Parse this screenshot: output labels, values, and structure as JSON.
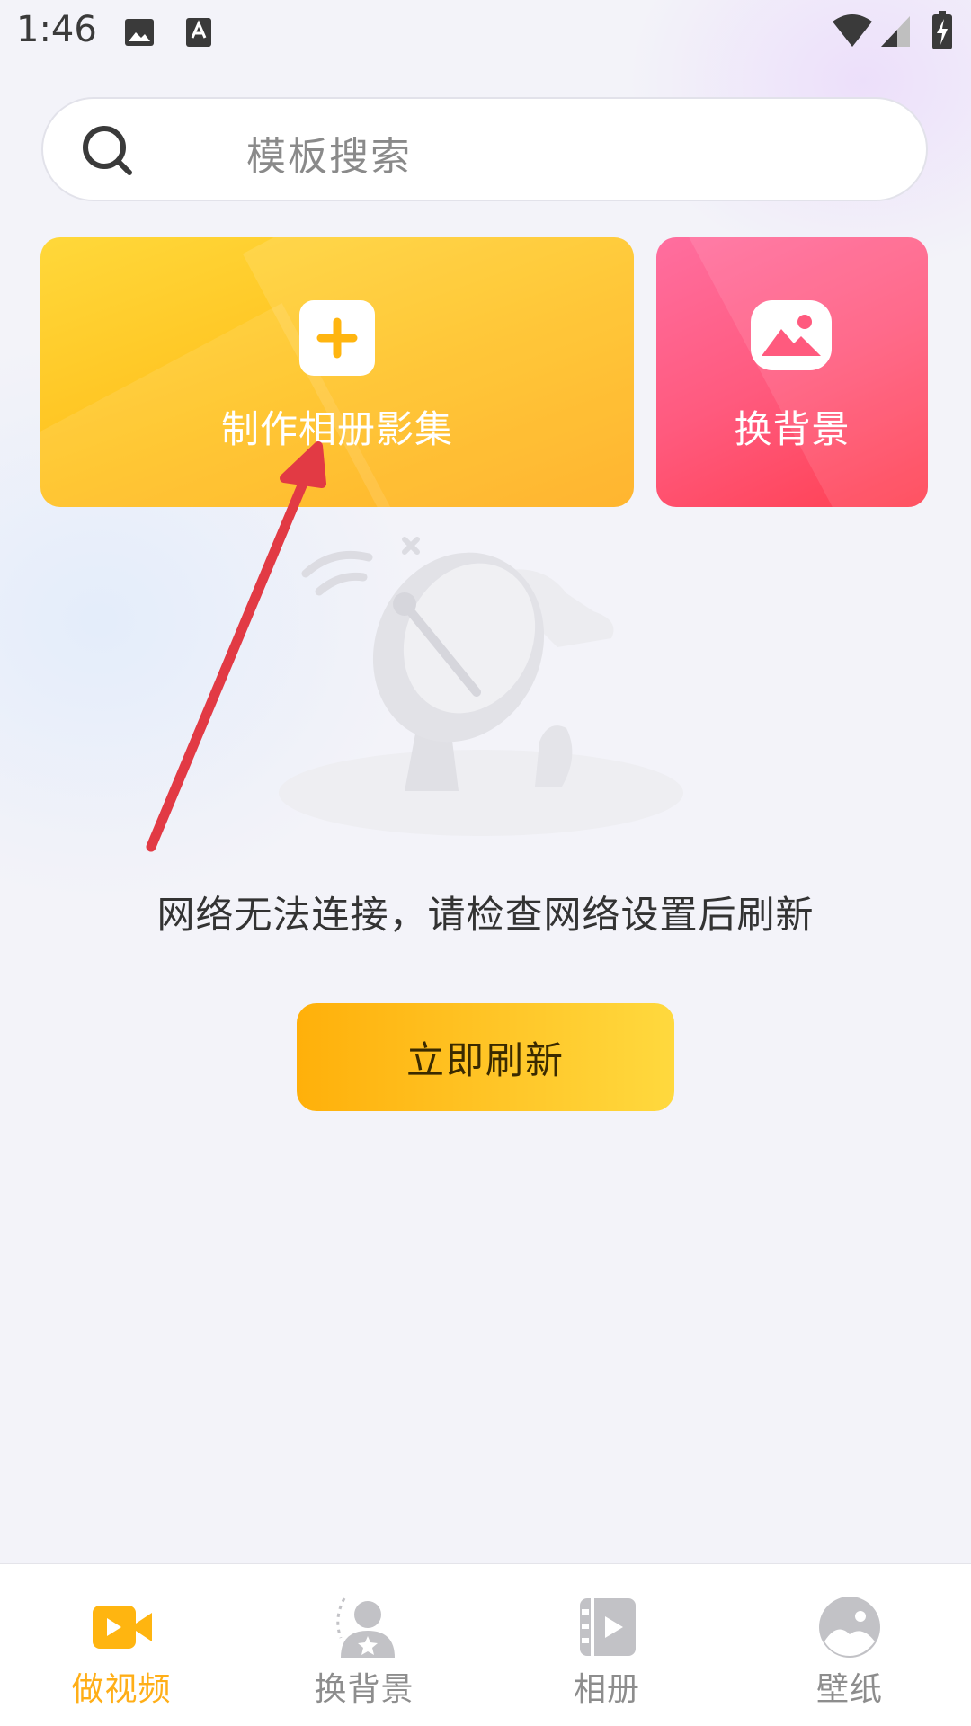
{
  "status_bar": {
    "time": "1:46"
  },
  "search": {
    "placeholder": "模板搜索",
    "icon": "search-icon"
  },
  "cards": [
    {
      "label": "制作相册影集",
      "icon": "plus-icon",
      "color": "#ffc21f"
    },
    {
      "label": "换背景",
      "icon": "image-icon",
      "color": "#ff5a7e"
    }
  ],
  "empty_state": {
    "illustration": "satellite-dish-illustration",
    "message": "网络无法连接，请检查网络设置后刷新",
    "refresh_label": "立即刷新"
  },
  "bottom_nav": {
    "items": [
      {
        "label": "做视频",
        "icon": "video-camera-icon",
        "active": true
      },
      {
        "label": "换背景",
        "icon": "person-star-icon",
        "active": false
      },
      {
        "label": "相册",
        "icon": "film-play-icon",
        "active": false
      },
      {
        "label": "壁纸",
        "icon": "wallpaper-icon",
        "active": false
      }
    ]
  },
  "colors": {
    "accent": "#ffae17",
    "pink": "#ff5a7e",
    "annotation_arrow": "#e23a44"
  }
}
